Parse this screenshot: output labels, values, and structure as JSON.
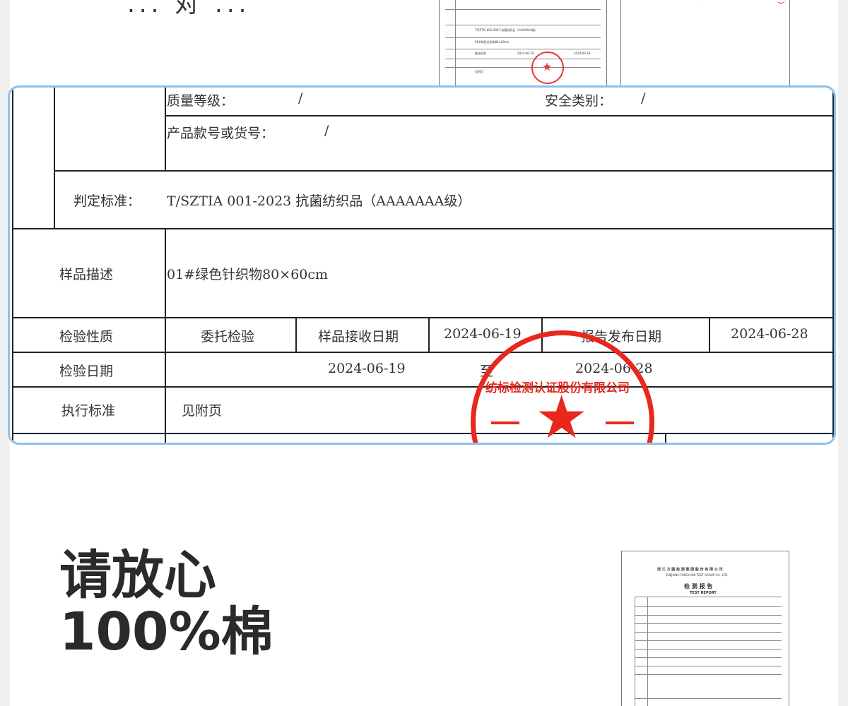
{
  "top_crop_text": "... 对 ...",
  "zoom_table": {
    "quality_grade_label": "质量等级：",
    "quality_grade_value": "/",
    "safety_category_label": "安全类别：",
    "safety_category_value": "/",
    "model_label": "产品款号或货号：",
    "model_value": "/",
    "standard_label": "判定标准：",
    "standard_value": "T/SZTIA 001-2023 抗菌纺织品（AAAAAAA级）",
    "sample_desc_label": "样品描述",
    "sample_desc_value": "01#绿色针织物80×60cm",
    "inspect_type_label": "检验性质",
    "inspect_type_value": "委托检验",
    "receive_date_label": "样品接收日期",
    "receive_date_value": "2024-06-19",
    "report_date_label": "报告发布日期",
    "report_date_value": "2024-06-28",
    "inspect_date_label": "检验日期",
    "inspect_date_start": "2024-06-19",
    "inspect_date_to": "至",
    "inspect_date_end": "2024-06-28",
    "exec_standard_label": "执行标准",
    "exec_standard_value": "见附页"
  },
  "stamp": {
    "text": "纺标检测认证股份有限公司",
    "color": "#e8281f"
  },
  "headline": {
    "line1": "请放心",
    "line2": "100%棉"
  },
  "thumb_top": {
    "lines": [
      "T/SZTIA 001-2023 抗菌纺织品（AAAAAAA级）",
      "01#绿色针织物80×60cm",
      "委托检验",
      "2024-06-19",
      "2024-06-28",
      "见附页"
    ]
  },
  "thumb_bottom": {
    "org": "浙 江 方 圆 检 测 集 团 股 份 有 限 公 司",
    "org_en": "ZHEJIANG FANGYUAN TEST GROUP CO., LTD.",
    "title": "检 测 报 告",
    "title_en": "TEST  REPORT"
  }
}
